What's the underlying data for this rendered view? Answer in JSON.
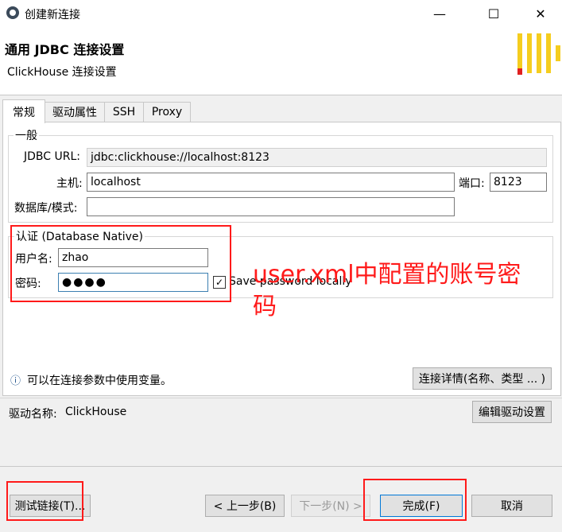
{
  "window": {
    "title": "创建新连接",
    "minimize": "—",
    "maximize": "☐",
    "close": "✕"
  },
  "header": {
    "title": "通用 JDBC 连接设置",
    "subtitle": "ClickHouse 连接设置"
  },
  "tabs": [
    {
      "label": "常规"
    },
    {
      "label": "驱动属性"
    },
    {
      "label": "SSH"
    },
    {
      "label": "Proxy"
    }
  ],
  "general": {
    "group_label": "一般",
    "jdbc_url_label": "JDBC URL:",
    "jdbc_url_value": "jdbc:clickhouse://localhost:8123",
    "host_label": "主机:",
    "host_value": "localhost",
    "port_label": "端口:",
    "port_value": "8123",
    "database_label": "数据库/模式:",
    "database_value": ""
  },
  "auth": {
    "group_label": "认证 (Database Native)",
    "username_label": "用户名:",
    "username_value": "zhao",
    "password_label": "密码:",
    "password_value": "●●●●",
    "save_password_label": "Save password locally",
    "save_password_checked": "✓"
  },
  "annotation": {
    "text_line1": "user.xml中配置的账号密",
    "text_line2": "码"
  },
  "info": {
    "icon": "ⓘ",
    "text": "可以在连接参数中使用变量。",
    "details_button": "连接详情(名称、类型 ... )"
  },
  "driver": {
    "label": "驱动名称:",
    "value": "ClickHouse",
    "edit_button": "编辑驱动设置"
  },
  "footer": {
    "test_button": "测试链接(T)...",
    "back_button": "< 上一步(B)",
    "next_button": "下一步(N) >",
    "finish_button": "完成(F)",
    "cancel_button": "取消"
  },
  "colors": {
    "highlight_red": "#ff1a1a",
    "logo_yellow": "#f5cd1f",
    "logo_red": "#e02020",
    "focus_blue": "#0078d7"
  }
}
